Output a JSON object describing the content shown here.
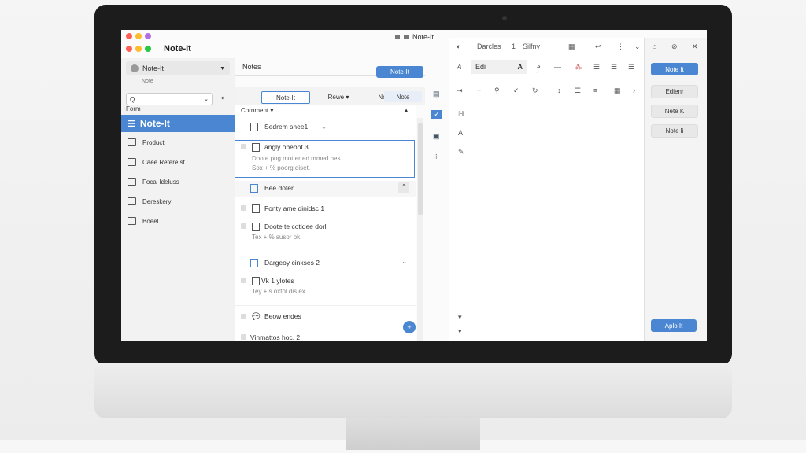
{
  "window": {
    "title": "Note-It",
    "app_name": "Note-It"
  },
  "sidebar": {
    "account": "Note-It",
    "account_sub": "Note",
    "search_placeholder": "Q",
    "form_label": "Form",
    "selected": "Note-It",
    "items": [
      {
        "label": "Product"
      },
      {
        "label": "Caee Refere st"
      },
      {
        "label": "Focal ldeluss"
      },
      {
        "label": "Dereskery"
      },
      {
        "label": "Boeel"
      }
    ]
  },
  "notes_header": {
    "label": "Notes",
    "button": "Note-It"
  },
  "tabs": [
    {
      "label": "Note-It"
    },
    {
      "label": "Rewe ▾"
    },
    {
      "label": "Notes ▾"
    },
    {
      "label": "Note"
    }
  ],
  "list": {
    "header": "Cornment",
    "rows": [
      {
        "title": "Sedrem shee1",
        "kind": "group"
      },
      {
        "title": "angly obeont.3",
        "line1": "Doote pog motter ed mmed hes",
        "line2": "Sox + % poorg diset."
      },
      {
        "title": "Bee doter",
        "kind": "group"
      },
      {
        "title": "Fonty ame dinidsc 1"
      },
      {
        "title": "Doote te cotidee dorl",
        "line1": "Tex + % susor ok."
      },
      {
        "title": "Dargeoy cinkses 2",
        "kind": "group"
      },
      {
        "title": "Vk 1 ylotes",
        "line1": "Tey + s oxtol dis ex."
      },
      {
        "title": "Beow endes"
      },
      {
        "title": "Vinmattos hoc. 2"
      }
    ]
  },
  "toolbar": {
    "top": [
      "Darcles",
      "1",
      "Silfny"
    ],
    "font": "Edi",
    "bold": "A",
    "note_button": "Note It"
  },
  "rightpanel": {
    "buttons": [
      "Edienr",
      "Nete K",
      "Note li"
    ],
    "apply": "Aplo It"
  },
  "colors": {
    "accent": "#4a86d1",
    "close": "#ff5f57",
    "min": "#febc2e",
    "max": "#28c840"
  }
}
